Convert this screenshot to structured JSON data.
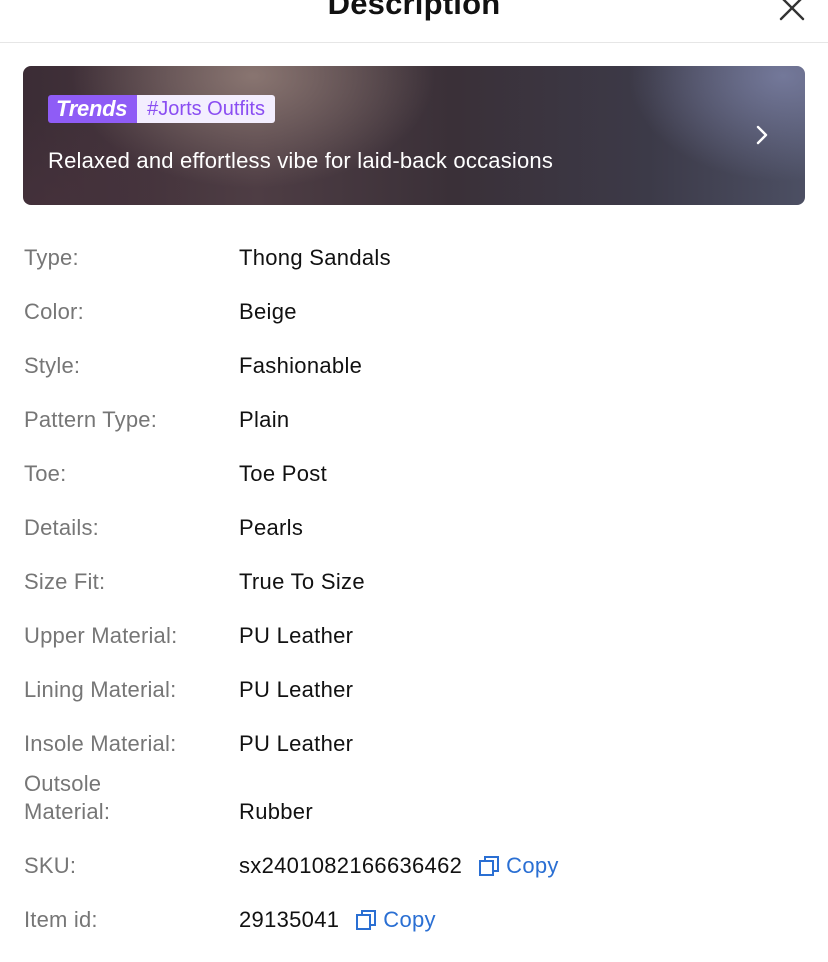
{
  "header": {
    "title": "Description"
  },
  "banner": {
    "brand": "Trends",
    "tag": "#Jorts Outfits",
    "text": "Relaxed and effortless vibe for laid-back occasions"
  },
  "specs": [
    {
      "label": "Type:",
      "value": "Thong Sandals"
    },
    {
      "label": "Color:",
      "value": "Beige"
    },
    {
      "label": "Style:",
      "value": "Fashionable"
    },
    {
      "label": "Pattern Type:",
      "value": "Plain"
    },
    {
      "label": "Toe:",
      "value": "Toe Post"
    },
    {
      "label": "Details:",
      "value": "Pearls"
    },
    {
      "label": "Size Fit:",
      "value": "True To Size"
    },
    {
      "label": "Upper Material:",
      "value": "PU Leather"
    },
    {
      "label": "Lining Material:",
      "value": "PU Leather"
    },
    {
      "label": "Insole Material:",
      "value": "PU Leather"
    },
    {
      "label": "Outsole Material:",
      "value": "Rubber"
    },
    {
      "label": "SKU:",
      "value": "sx2401082166636462",
      "copy_label": "Copy"
    },
    {
      "label": "Item id:",
      "value": "29135041",
      "copy_label": "Copy"
    }
  ],
  "colors": {
    "accent": "#2a6fd3",
    "trends_purple": "#8f5cf6",
    "label_gray": "#767676"
  },
  "icons": {
    "close": "close-icon",
    "chevron": "chevron-right-icon",
    "copy": "copy-icon"
  }
}
